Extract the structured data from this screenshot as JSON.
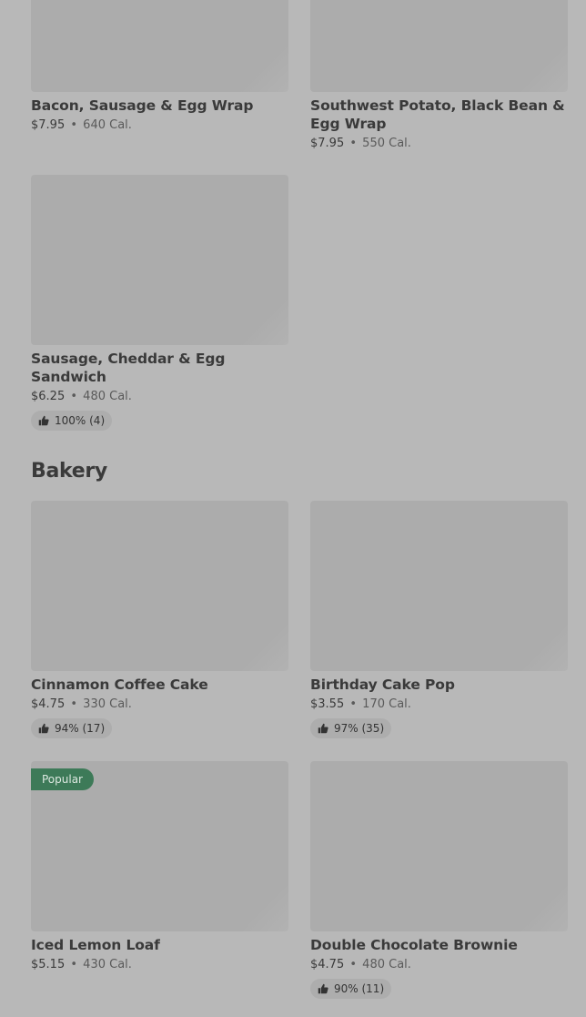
{
  "top_items": [
    {
      "name": "Bacon, Sausage & Egg Wrap",
      "price": "$7.95",
      "calories": "640 Cal."
    },
    {
      "name": "Southwest Potato, Black Bean & Egg Wrap",
      "price": "$7.95",
      "calories": "550 Cal."
    },
    {
      "name": "Sausage, Cheddar & Egg Sandwich",
      "price": "$6.25",
      "calories": "480 Cal.",
      "rating": "100% (4)"
    }
  ],
  "bakery": {
    "title": "Bakery",
    "items": [
      {
        "name": "Cinnamon Coffee Cake",
        "price": "$4.75",
        "calories": "330 Cal.",
        "rating": "94% (17)"
      },
      {
        "name": "Birthday Cake Pop",
        "price": "$3.55",
        "calories": "170 Cal.",
        "rating": "97% (35)"
      },
      {
        "name": "Iced Lemon Loaf",
        "price": "$5.15",
        "calories": "430 Cal.",
        "badge": "Popular"
      },
      {
        "name": "Double Chocolate Brownie",
        "price": "$4.75",
        "calories": "480 Cal.",
        "rating": "90% (11)"
      }
    ]
  },
  "separator": "•",
  "icons": {
    "rating": "thumbs-up-icon"
  },
  "colors": {
    "badge": "#3d7a58",
    "background": "#b8b8b8"
  }
}
